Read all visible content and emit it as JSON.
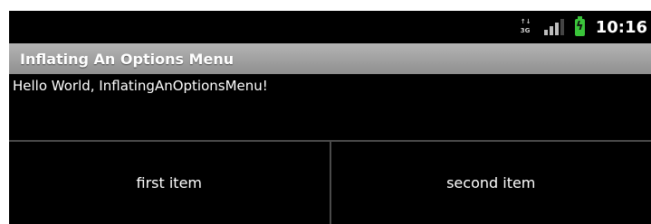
{
  "status_bar": {
    "network_type": "3G",
    "network_top_label": "↑↓",
    "signal_bars": 3,
    "battery_charging": true,
    "time": "10:16"
  },
  "app": {
    "title": "Inflating An Options Menu",
    "content_text": "Hello World, InflatingAnOptionsMenu!"
  },
  "options_menu": {
    "items": [
      {
        "label": "first item"
      },
      {
        "label": "second item"
      }
    ]
  },
  "colors": {
    "background": "#000000",
    "title_bar": "#9e9e9e",
    "battery": "#3ac43a",
    "divider": "#4a4a4a"
  }
}
